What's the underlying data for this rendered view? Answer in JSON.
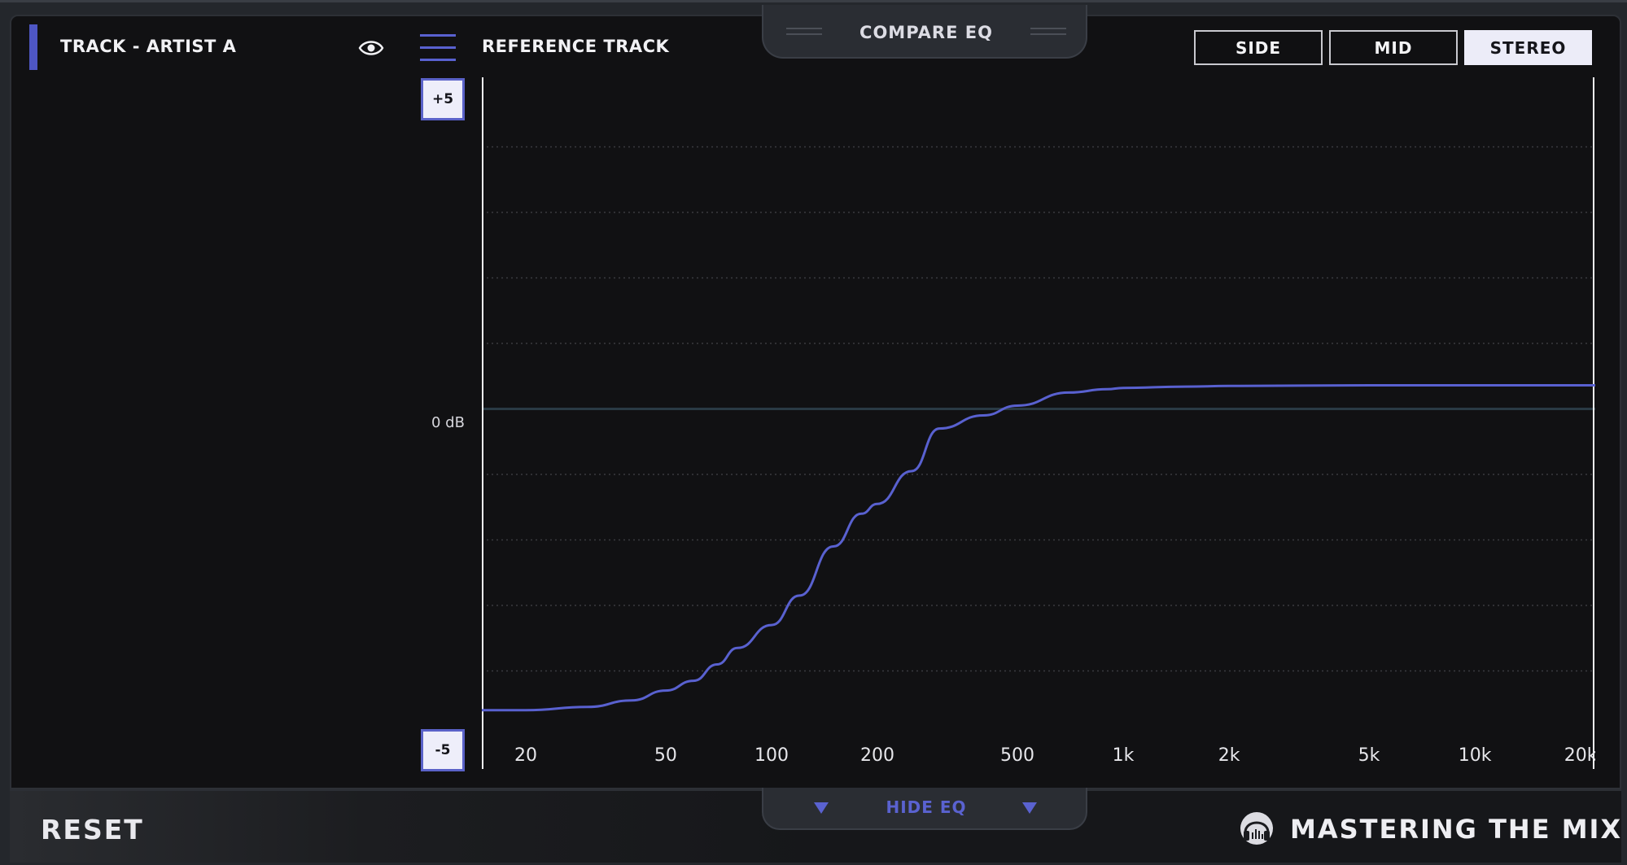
{
  "header": {
    "compare_title": "COMPARE EQ",
    "track_label": "TRACK - ARTIST A",
    "reference_label": "REFERENCE TRACK",
    "modes": [
      "SIDE",
      "MID",
      "STEREO"
    ],
    "active_mode": "STEREO"
  },
  "icons": {
    "visibility": "eye-icon",
    "menu": "menu-icon",
    "logo": "headphones-logo-icon",
    "collapse": "triangle-down-icon"
  },
  "eq": {
    "top_label": "+5",
    "bottom_label": "-5",
    "zero_label": "0 dB"
  },
  "chart_data": {
    "type": "line",
    "x_scale": "log",
    "xlim": [
      15,
      22000
    ],
    "ylim": [
      -5,
      5
    ],
    "x_ticks": [
      20,
      50,
      100,
      200,
      500,
      1000,
      2000,
      5000,
      10000,
      20000
    ],
    "x_tick_labels": [
      "20",
      "50",
      "100",
      "200",
      "500",
      "1k",
      "2k",
      "5k",
      "10k",
      "20k"
    ],
    "grid": true,
    "series": [
      {
        "x": [
          15,
          20,
          30,
          40,
          50,
          60,
          70,
          80,
          100,
          120,
          150,
          180,
          200,
          250,
          300,
          400,
          500,
          700,
          900,
          1000,
          1500,
          2000,
          5000,
          10000,
          22000
        ],
        "y": [
          -4.6,
          -4.6,
          -4.55,
          -4.45,
          -4.3,
          -4.15,
          -3.9,
          -3.65,
          -3.3,
          -2.85,
          -2.1,
          -1.6,
          -1.45,
          -0.95,
          -0.3,
          -0.1,
          0.05,
          0.25,
          0.3,
          0.32,
          0.34,
          0.35,
          0.36,
          0.36,
          0.36
        ]
      }
    ],
    "line_color": "#5961d0",
    "zero_line_color": "#2a3a44"
  },
  "footer": {
    "reset_label": "RESET",
    "hide_label": "HIDE EQ",
    "brand": "MASTERING THE MIX"
  },
  "colors": {
    "accent": "#5961d0",
    "background": "#111113",
    "active_button": "#ececf8"
  }
}
